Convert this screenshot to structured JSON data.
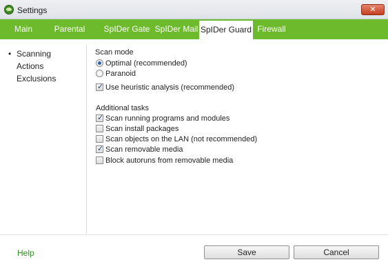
{
  "window": {
    "title": "Settings",
    "close_label": "✕"
  },
  "tabs": [
    {
      "label": "Main",
      "active": false
    },
    {
      "label": "Parental Control",
      "active": false
    },
    {
      "label": "SpIDer Gate",
      "active": false
    },
    {
      "label": "SpIDer Mail",
      "active": false
    },
    {
      "label": "SpIDer Guard",
      "active": true
    },
    {
      "label": "Firewall",
      "active": false
    }
  ],
  "sidebar": {
    "bullet": "•",
    "items": [
      {
        "label": "Scanning",
        "selected": true
      },
      {
        "label": "Actions",
        "selected": false
      },
      {
        "label": "Exclusions",
        "selected": false
      }
    ]
  },
  "scan_mode": {
    "title": "Scan mode",
    "options": [
      {
        "label": "Optimal (recommended)",
        "selected": true
      },
      {
        "label": "Paranoid",
        "selected": false
      }
    ]
  },
  "heuristic": {
    "label": "Use heuristic analysis (recommended)",
    "checked": true
  },
  "additional_tasks": {
    "title": "Additional tasks",
    "items": [
      {
        "label": "Scan running programs and modules",
        "checked": true
      },
      {
        "label": "Scan install packages",
        "checked": false
      },
      {
        "label": "Scan objects on the LAN (not recommended)",
        "checked": false
      },
      {
        "label": "Scan removable media",
        "checked": true
      },
      {
        "label": "Block autoruns from removable media",
        "checked": false
      }
    ]
  },
  "check_glyph": "✓",
  "footer": {
    "help_label": "Help",
    "save_label": "Save",
    "cancel_label": "Cancel"
  },
  "colors": {
    "accent_green": "#6dba2c",
    "help_link": "#2e8b1f",
    "close_red": "#c4401f"
  }
}
